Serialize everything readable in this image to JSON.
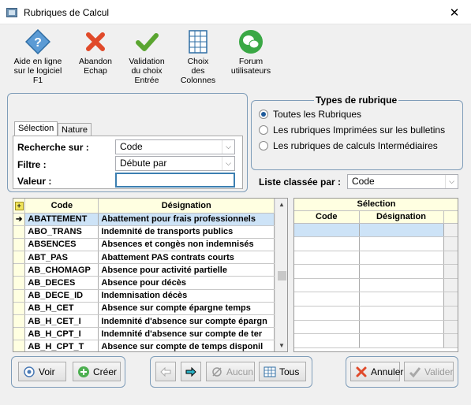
{
  "window": {
    "title": "Rubriques de Calcul",
    "close_label": "✕"
  },
  "toolbar": {
    "help": {
      "line1": "Aide en ligne",
      "line2": "sur le logiciel",
      "line3": "F1"
    },
    "abort": {
      "line1": "Abandon",
      "line2": "Echap"
    },
    "validate": {
      "line1": "Validation",
      "line2": "du choix",
      "line3": "Entrée"
    },
    "columns": {
      "line1": "Choix",
      "line2": "des",
      "line3": "Colonnes"
    },
    "forum": {
      "line1": "Forum",
      "line2": "utilisateurs"
    }
  },
  "tabs": {
    "selection": "Sélection",
    "nature": "Nature"
  },
  "search": {
    "search_label": "Recherche sur :",
    "search_value": "Code",
    "filter_label": "Filtre :",
    "filter_value": "Débute par",
    "value_label": "Valeur :",
    "value_input": ""
  },
  "types": {
    "legend": "Types de rubrique",
    "options": [
      {
        "label": "Toutes les Rubriques",
        "selected": true
      },
      {
        "label": "Les rubriques Imprimées sur les bulletins",
        "selected": false
      },
      {
        "label": "Les rubriques de calculs Intermédiaires",
        "selected": false
      }
    ]
  },
  "sort": {
    "label": "Liste classée par :",
    "value": "Code"
  },
  "main_table": {
    "columns": [
      "Code",
      "Désignation"
    ],
    "rows": [
      {
        "code": "ABATTEMENT",
        "designation": "Abattement pour frais professionnels"
      },
      {
        "code": "ABO_TRANS",
        "designation": "Indemnité de transports publics"
      },
      {
        "code": "ABSENCES",
        "designation": "Absences et congès non indemnisés"
      },
      {
        "code": "ABT_PAS",
        "designation": "Abattement PAS contrats courts"
      },
      {
        "code": "AB_CHOMAGP",
        "designation": "Absence pour activité partielle"
      },
      {
        "code": "AB_DECES",
        "designation": "Absence pour décès"
      },
      {
        "code": "AB_DECE_ID",
        "designation": "Indemnisation décès"
      },
      {
        "code": "AB_H_CET",
        "designation": "Absence sur compte épargne temps"
      },
      {
        "code": "AB_H_CET_I",
        "designation": "Indemnité d'absence sur compte épargn"
      },
      {
        "code": "AB_H_CPT_I",
        "designation": "Indemnité d'absence sur compte de ter"
      },
      {
        "code": "AB_H_CPT_T",
        "designation": "Absence sur compte de temps disponil"
      }
    ]
  },
  "selection_table": {
    "title": "Sélection",
    "columns": [
      "Code",
      "Désignation"
    ]
  },
  "buttons": {
    "voir": "Voir",
    "creer": "Créer",
    "aucun": "Aucun",
    "tous": "Tous",
    "annuler": "Annuler",
    "valider": "Valider"
  },
  "colors": {
    "accent": "#3c7fb1",
    "selected_row": "#cde3f7",
    "header": "#ffffe1"
  }
}
